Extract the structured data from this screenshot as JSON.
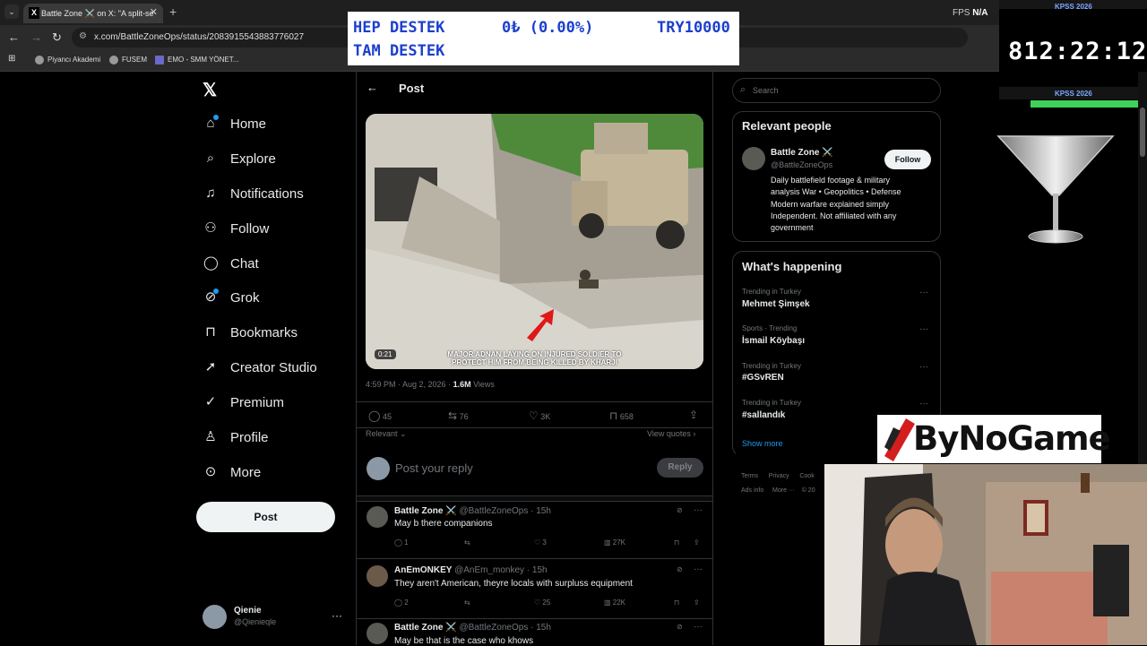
{
  "browser": {
    "tab_title": "Battle Zone ⚔️ on X: \"A split-se",
    "url": "x.com/BattleZoneOps/status/2083915543883776027",
    "bookmarks": [
      "Piyancı Akademi",
      "FUSEM",
      "EMO - SMM YÖNET..."
    ],
    "fps_label": "FPS",
    "fps_value": "N/A"
  },
  "banner": {
    "line1_left": "HEP DESTEK",
    "line1_mid": "0₺ (0.00%)",
    "line1_right": "TRY10000",
    "line2": "TAM DESTEK"
  },
  "timer": {
    "top_label": "KPSS 2026",
    "value": "812:22:12",
    "bottom_label": "KPSS 2026"
  },
  "sidebar": {
    "items": [
      {
        "label": "Home",
        "icon": "home-icon"
      },
      {
        "label": "Explore",
        "icon": "search-icon"
      },
      {
        "label": "Notifications",
        "icon": "bell-icon"
      },
      {
        "label": "Follow",
        "icon": "add-user-icon"
      },
      {
        "label": "Chat",
        "icon": "chat-icon"
      },
      {
        "label": "Grok",
        "icon": "grok-icon"
      },
      {
        "label": "Bookmarks",
        "icon": "bookmark-icon"
      },
      {
        "label": "Creator Studio",
        "icon": "rocket-icon"
      },
      {
        "label": "Premium",
        "icon": "verified-icon"
      },
      {
        "label": "Profile",
        "icon": "person-icon"
      },
      {
        "label": "More",
        "icon": "more-icon"
      }
    ],
    "post_button": "Post",
    "user": {
      "name": "Qienie",
      "handle": "@Qienieqle"
    }
  },
  "post": {
    "header": "Post",
    "video_duration": "0:21",
    "caption_line1": "MAJOR ADNAN LAYING ON INJURED SOLDIER TO",
    "caption_line2": "PROTECT HIM FROM BEING KILLED BY KHARJI",
    "timestamp": "4:59 PM · Aug 2, 2026 · ",
    "views_count": "1.6M",
    "views_label": " Views",
    "replies": "45",
    "reposts": "76",
    "likes": "3K",
    "bookmarks": "658",
    "sort": "Relevant",
    "view_quotes": "View quotes",
    "reply_placeholder": "Post your reply",
    "reply_button": "Reply"
  },
  "replies": [
    {
      "name": "Battle Zone ⚔️",
      "handle": "@BattleZoneOps · 15h",
      "text": "May b there companions",
      "replies": "1",
      "reposts": "",
      "likes": "3",
      "views": "27K"
    },
    {
      "name": "AnEmONKEY",
      "handle": "@AnEm_monkey · 15h",
      "text": "They aren't American, theyre locals with surpluss equipment",
      "replies": "2",
      "reposts": "",
      "likes": "25",
      "views": "22K"
    },
    {
      "name": "Battle Zone ⚔️",
      "handle": "@BattleZoneOps · 15h",
      "text": "May be that is the case who khows",
      "replies": "",
      "reposts": "",
      "likes": "",
      "views": ""
    }
  ],
  "right": {
    "search_placeholder": "Search",
    "relevant_title": "Relevant people",
    "person": {
      "name": "Battle Zone ⚔️",
      "handle": "@BattleZoneOps",
      "follow": "Follow",
      "bio": [
        "Daily battlefield footage & military",
        "analysis War • Geopolitics • Defense",
        "Modern warfare explained simply",
        "Independent. Not affiliated with any",
        "government"
      ]
    },
    "happening_title": "What's happening",
    "trends": [
      {
        "context": "Trending in Turkey",
        "name": "Mehmet Şimşek"
      },
      {
        "context": "Sports · Trending",
        "name": "İsmail Köybaşı"
      },
      {
        "context": "Trending in Turkey",
        "name": "#GSvREN"
      },
      {
        "context": "Trending in Turkey",
        "name": "#sallandık"
      }
    ],
    "show_more": "Show more",
    "footer1": [
      "Terms",
      "Privacy",
      "Cook"
    ],
    "footer2": [
      "Ads info",
      "More ···",
      "© 20"
    ]
  },
  "bynogame": "ByNoGame",
  "colors": {
    "accent": "#1d9bf0",
    "banner_text": "#1c3fcc",
    "timer_bar": "#3fd15a"
  }
}
